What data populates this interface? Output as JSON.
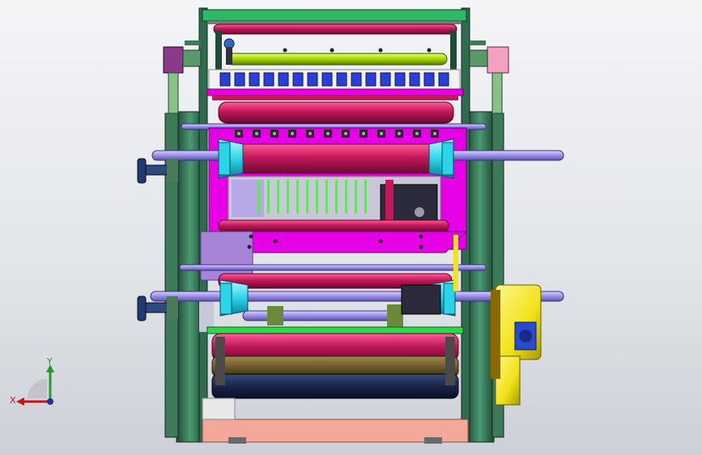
{
  "viewport": {
    "background_top": "#f4f5f7",
    "background_bottom": "#cdd1d7"
  },
  "colors": {
    "frame_green": "#2e6b4f",
    "plate_magenta": "#e600e6",
    "roller_crimson": "#c4185a",
    "shaft_lavender": "#9a8fe8",
    "cone_cyan": "#2bd5e8",
    "knob_navy": "#1f3a6e",
    "motor_yellow": "#f2e21a",
    "base_salmon": "#f4a89a",
    "lime_bar": "#a6d400",
    "cutter_blue": "#2a3fd8"
  },
  "triad": {
    "x_label": "X",
    "y_label": "Y",
    "x_color": "#d01010",
    "y_color": "#20a020"
  }
}
